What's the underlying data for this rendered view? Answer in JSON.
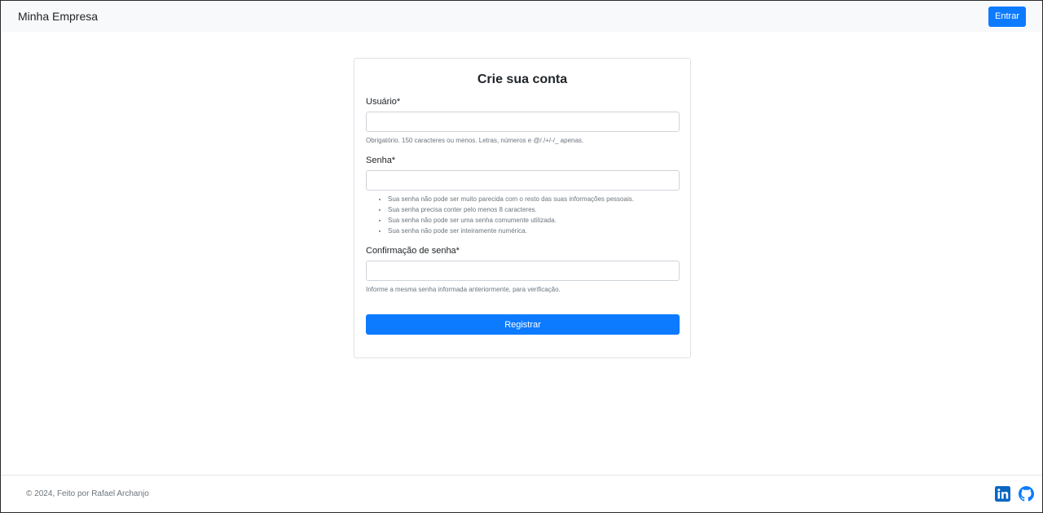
{
  "navbar": {
    "brand": "Minha Empresa",
    "login_label": "Entrar"
  },
  "form": {
    "title": "Crie sua conta",
    "username": {
      "label": "Usuário*",
      "value": "",
      "help": "Obrigatório. 150 caracteres ou menos. Letras, números e @/./+/-/_ apenas."
    },
    "password": {
      "label": "Senha*",
      "value": "",
      "help_items": [
        "Sua senha não pode ser muito parecida com o resto das suas informações pessoais.",
        "Sua senha precisa conter pelo menos 8 caracteres.",
        "Sua senha não pode ser uma senha comumente utilizada.",
        "Sua senha não pode ser inteiramente numérica."
      ]
    },
    "password_confirm": {
      "label": "Confirmação de senha*",
      "value": "",
      "help": "Informe a mesma senha informada anteriormente, para verificação."
    },
    "submit_label": "Registrar"
  },
  "footer": {
    "text": "© 2024, Feito por Rafael Archanjo",
    "social": [
      {
        "icon": "linkedin-icon",
        "color": "#0a66c2"
      },
      {
        "icon": "github-icon",
        "color": "#0d7bff"
      }
    ]
  },
  "colors": {
    "primary": "#0d7bff",
    "navbar_bg": "#f8f9fa",
    "muted_text": "#6c757d"
  }
}
